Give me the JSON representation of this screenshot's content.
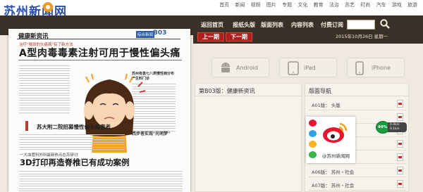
{
  "site": {
    "logo_text": "苏州新闻网",
    "logo_sub": "SUZHOU NEWS"
  },
  "top_nav": [
    "首页",
    "新闻",
    "视频",
    "图片",
    "专题",
    "文化",
    "教育",
    "法治",
    "苏艺",
    "时尚",
    "汽车",
    "游戏",
    "旅游"
  ],
  "main_nav": {
    "home": "返回首页",
    "catalog": "报纸头版",
    "layout_list": "版面列表",
    "content_list": "内容列表",
    "subscribe": "付费订阅",
    "search_placeholder": ""
  },
  "pager": {
    "prev": "上一期",
    "next": "下一期",
    "date": "2015年10月26日 星期一"
  },
  "newspaper": {
    "section_title": "健康新资讯",
    "tag": "综合新闻",
    "page_no": "B03",
    "kicker": "治疗\"慢顽的头痛病\"有了新方法",
    "headline": "A型肉毒毒素注射可用于慢性偏头痛",
    "side_head1": "苏州有患七八类慢性病分布产生料门诊",
    "subhead": "苏大附二院招募慢性偏头痛患者",
    "side_head2": "西步者实现\"光明梦\"",
    "kicker2": "一大血管科外科最新热点在苏研讨",
    "headline2": "3D打印再造脊椎已有成功案例"
  },
  "devices": {
    "android": "Android",
    "ipad": "iPad",
    "iphone": "iPhone"
  },
  "content_box": {
    "title": "第B03版：健康新资讯"
  },
  "nav_box": {
    "title": "版面导航",
    "items": [
      {
        "label": "A01版： 头版"
      },
      {
        "label": ""
      },
      {
        "label": ""
      },
      {
        "label": ""
      },
      {
        "label": ""
      },
      {
        "label": "A06版： 苏州・社会"
      },
      {
        "label": "A07版： 苏州・社会"
      }
    ]
  },
  "share": {
    "label": "@苏州新闻网"
  },
  "float_widget": {
    "percent": "40%",
    "up": "0.4k/s",
    "down": "0.1k/s"
  }
}
